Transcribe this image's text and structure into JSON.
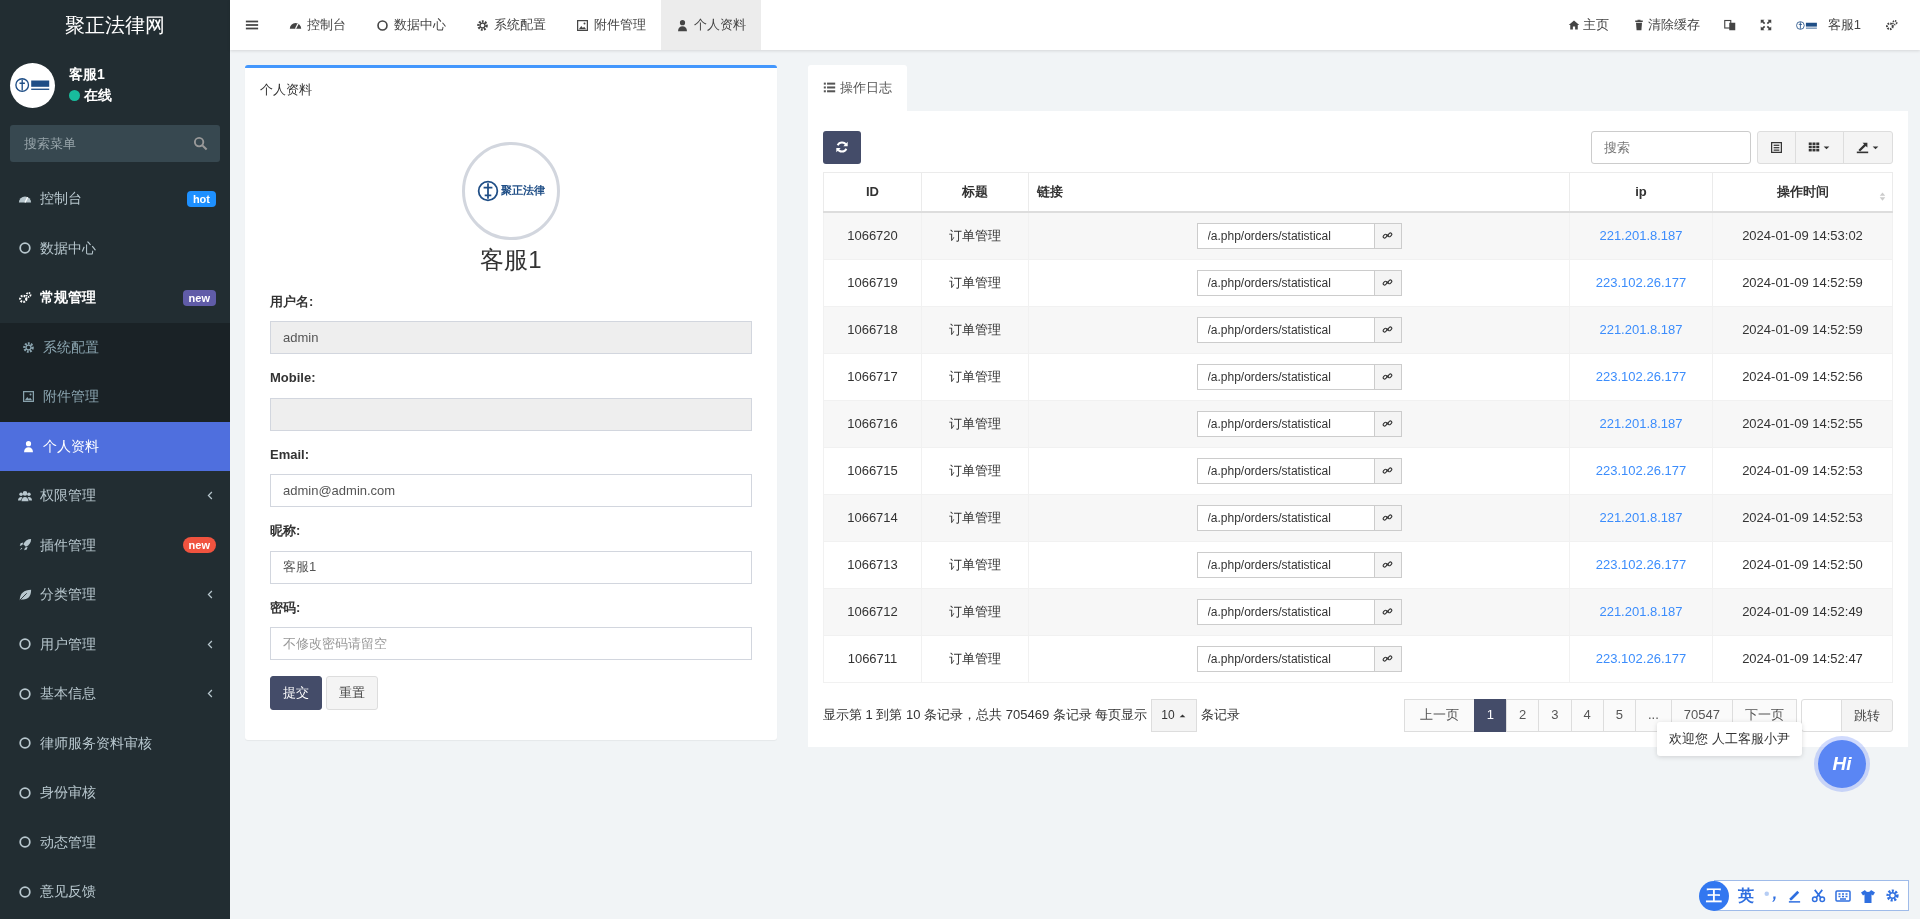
{
  "brand": "聚正法律网",
  "user_panel": {
    "name": "客服1",
    "status": "在线",
    "online": true
  },
  "sidebar": {
    "search": {
      "placeholder": "搜索菜单"
    },
    "items": [
      {
        "label": "控制台",
        "selected": false,
        "badge": {
          "text": "hot",
          "color": "#1e90ff"
        }
      },
      {
        "label": "数据中心",
        "selected": false
      },
      {
        "label": "常规管理",
        "selected": false,
        "expanded": true,
        "badge": {
          "text": "new",
          "color": "#605ca8"
        },
        "children": [
          {
            "label": "系统配置",
            "selected": false
          },
          {
            "label": "附件管理",
            "selected": false
          },
          {
            "label": "个人资料",
            "selected": true
          }
        ]
      },
      {
        "label": "权限管理",
        "selected": false,
        "expanded": false
      },
      {
        "label": "插件管理",
        "selected": false,
        "badge": {
          "text": "new",
          "color": "#f0533f"
        }
      },
      {
        "label": "分类管理",
        "selected": false,
        "expanded": false
      },
      {
        "label": "用户管理",
        "selected": false,
        "expanded": false
      },
      {
        "label": "基本信息",
        "selected": false,
        "expanded": false
      },
      {
        "label": "律师服务资料审核",
        "selected": false
      },
      {
        "label": "身份审核",
        "selected": false
      },
      {
        "label": "动态管理",
        "selected": false
      },
      {
        "label": "意见反馈",
        "selected": false
      }
    ]
  },
  "header": {
    "tabs": [
      {
        "label": "控制台",
        "selected": false
      },
      {
        "label": "数据中心",
        "selected": false
      },
      {
        "label": "系统配置",
        "selected": false
      },
      {
        "label": "附件管理",
        "selected": false
      },
      {
        "label": "个人资料",
        "selected": true
      }
    ],
    "links": [
      "主页",
      "清除缓存"
    ],
    "user": "客服1"
  },
  "profile_card": {
    "title": "个人资料",
    "logo_text": "聚正法律",
    "name": "客服1",
    "fields": [
      {
        "label": "用户名:",
        "value": "admin",
        "disabled": true
      },
      {
        "label": "Mobile:",
        "disabled": true
      },
      {
        "label": "Email:",
        "value": "admin@admin.com",
        "disabled": false
      },
      {
        "label": "昵称:",
        "value": "客服1",
        "disabled": false
      },
      {
        "label": "密码:",
        "placeholder": "不修改密码请留空",
        "disabled": false
      }
    ],
    "buttons": [
      {
        "label": "提交",
        "kind": "primary"
      },
      {
        "label": "重置",
        "kind": "default"
      }
    ]
  },
  "log_panel": {
    "tab": {
      "label": "操作日志",
      "selected": true
    },
    "search": {
      "placeholder": "搜索"
    },
    "table": {
      "columns": [
        "ID",
        "标题",
        "链接",
        "ip",
        "操作时间"
      ],
      "rows": [
        {
          "id": "1066720",
          "title": "订单管理",
          "link": "/a.php/orders/statistical",
          "ip": "221.201.8.187",
          "time": "2024-01-09 14:53:02"
        },
        {
          "id": "1066719",
          "title": "订单管理",
          "link": "/a.php/orders/statistical",
          "ip": "223.102.26.177",
          "time": "2024-01-09 14:52:59"
        },
        {
          "id": "1066718",
          "title": "订单管理",
          "link": "/a.php/orders/statistical",
          "ip": "221.201.8.187",
          "time": "2024-01-09 14:52:59"
        },
        {
          "id": "1066717",
          "title": "订单管理",
          "link": "/a.php/orders/statistical",
          "ip": "223.102.26.177",
          "time": "2024-01-09 14:52:56"
        },
        {
          "id": "1066716",
          "title": "订单管理",
          "link": "/a.php/orders/statistical",
          "ip": "221.201.8.187",
          "time": "2024-01-09 14:52:55"
        },
        {
          "id": "1066715",
          "title": "订单管理",
          "link": "/a.php/orders/statistical",
          "ip": "223.102.26.177",
          "time": "2024-01-09 14:52:53"
        },
        {
          "id": "1066714",
          "title": "订单管理",
          "link": "/a.php/orders/statistical",
          "ip": "221.201.8.187",
          "time": "2024-01-09 14:52:53"
        },
        {
          "id": "1066713",
          "title": "订单管理",
          "link": "/a.php/orders/statistical",
          "ip": "223.102.26.177",
          "time": "2024-01-09 14:52:50"
        },
        {
          "id": "1066712",
          "title": "订单管理",
          "link": "/a.php/orders/statistical",
          "ip": "221.201.8.187",
          "time": "2024-01-09 14:52:49"
        },
        {
          "id": "1066711",
          "title": "订单管理",
          "link": "/a.php/orders/statistical",
          "ip": "223.102.26.177",
          "time": "2024-01-09 14:52:47"
        }
      ]
    },
    "pagination": {
      "summary": "显示第 1 到第 10 条记录，总共 705469 条记录 每页显示",
      "page_size": "10",
      "summary_end": "条记录",
      "pages": [
        {
          "label": "上一页",
          "selected": false
        },
        {
          "label": "1",
          "selected": true
        },
        {
          "label": "2",
          "selected": false
        },
        {
          "label": "3",
          "selected": false
        },
        {
          "label": "4",
          "selected": false
        },
        {
          "label": "5",
          "selected": false
        },
        {
          "label": "...",
          "selected": false
        },
        {
          "label": "70547",
          "selected": false
        },
        {
          "label": "下一页",
          "selected": false
        }
      ],
      "jump_button": "跳转"
    }
  },
  "chat": {
    "greeting": "欢迎您 人工客服小尹",
    "button": "Hi"
  },
  "ime": {
    "logo": "王",
    "mode": "英"
  }
}
